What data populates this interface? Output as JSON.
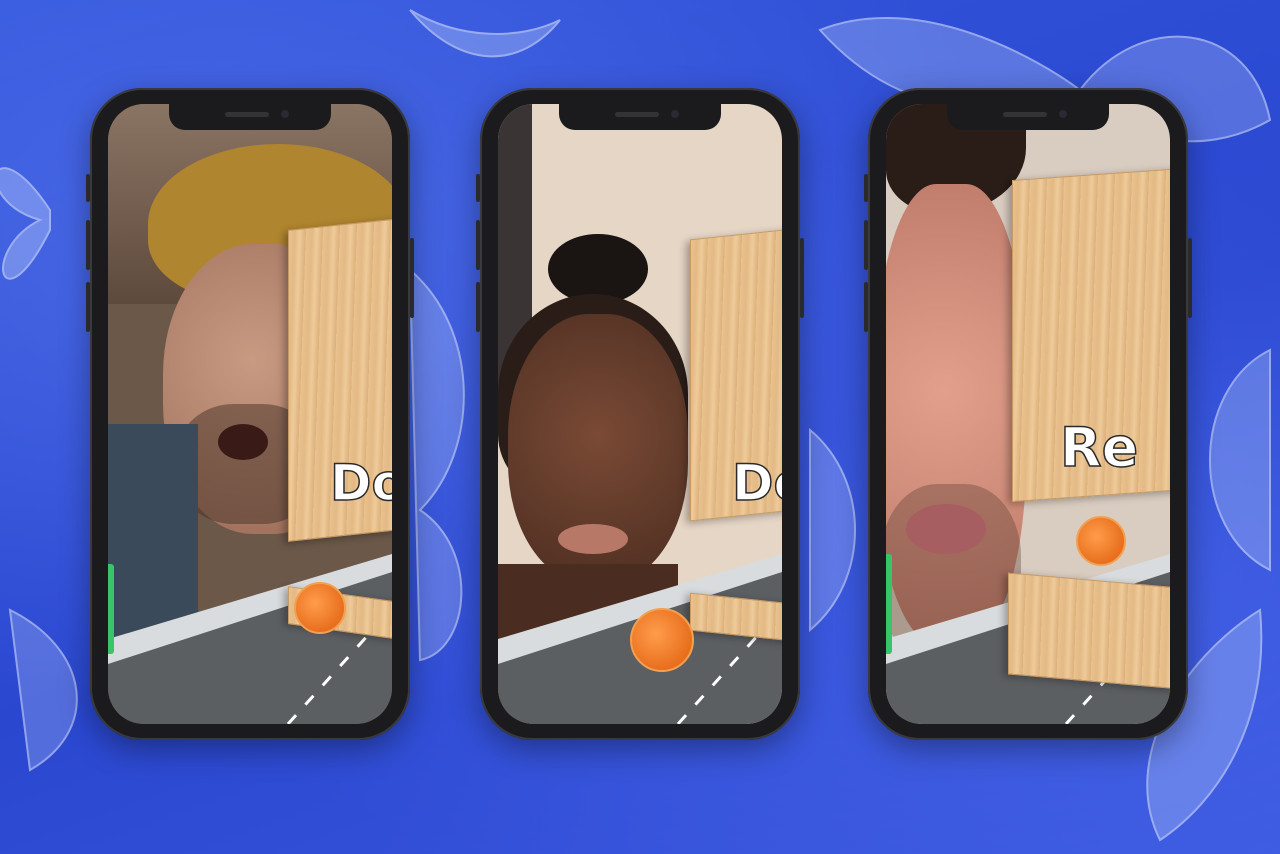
{
  "phones": [
    {
      "overlay_text": "Do"
    },
    {
      "overlay_text": "Do"
    },
    {
      "overlay_text": "Re"
    }
  ],
  "colors": {
    "background": "#2f4fd6",
    "phone_frame": "#1b1b1d",
    "door_wood": "#e9c28f",
    "cookie_orange": "#f08a35"
  },
  "icons": [
    "butterfly-graphic",
    "front-camera-icon",
    "speaker-grille"
  ]
}
